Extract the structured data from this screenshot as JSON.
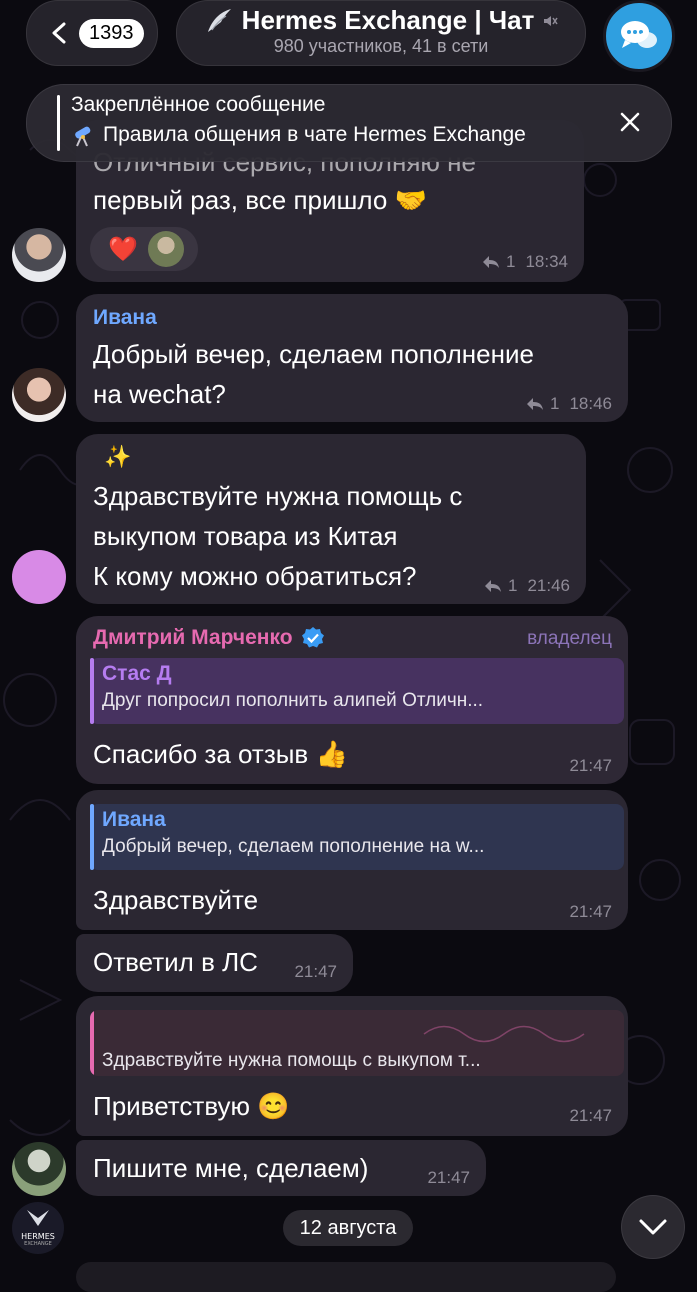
{
  "header": {
    "back_count": "1393",
    "title": "Hermes Exchange | Чат",
    "subtitle": "980 участников, 41 в сети"
  },
  "pinned": {
    "title": "Закреплённое сообщение",
    "text": "Правила общения в чате Hermes Exchange"
  },
  "messages": [
    {
      "partial_top_text": "Отличный сервис, пополняю не",
      "text": "первый раз, все пришло 🤝",
      "reactions": [
        "❤️"
      ],
      "replies": "1",
      "time": "18:34"
    },
    {
      "sender": "Ивана",
      "text_line1": "Добрый вечер, сделаем пополнение",
      "text_line2": "на wechat?",
      "replies": "1",
      "time": "18:46"
    },
    {
      "sparkle": "✨",
      "text_line1": "Здравствуйте нужна помощь с",
      "text_line2": "выкупом товара из Китая",
      "text_line3": "К кому можно обратиться?",
      "replies": "1",
      "time": "21:46"
    },
    {
      "sender": "Дмитрий Марченко",
      "badge": "владелец",
      "reply_name": "Стас Д",
      "reply_text": "Друг попросил пополнить алипей Отличн...",
      "text": "Спасибо за отзыв 👍",
      "time": "21:47"
    },
    {
      "reply_name": "Ивана",
      "reply_text": "Добрый вечер, сделаем пополнение на w...",
      "text": "Здравствуйте",
      "time": "21:47"
    },
    {
      "text": "Ответил в ЛС",
      "time": "21:47"
    },
    {
      "reply_text": "Здравствуйте нужна помощь с выкупом т...",
      "text": "Приветствую 😊",
      "time": "21:47"
    },
    {
      "text": "Пишите мне, сделаем)",
      "time": "21:47"
    }
  ],
  "date_divider": "12 августа",
  "logo": {
    "line1": "HERMES",
    "line2": "EXCHANGE"
  },
  "colors": {
    "bubble": "#2b2732",
    "accent_blue": "#6fa8ff",
    "owner_name": "#e66ab0",
    "reply_purple": "#b57cf0",
    "verified": "#3a9cf5"
  }
}
